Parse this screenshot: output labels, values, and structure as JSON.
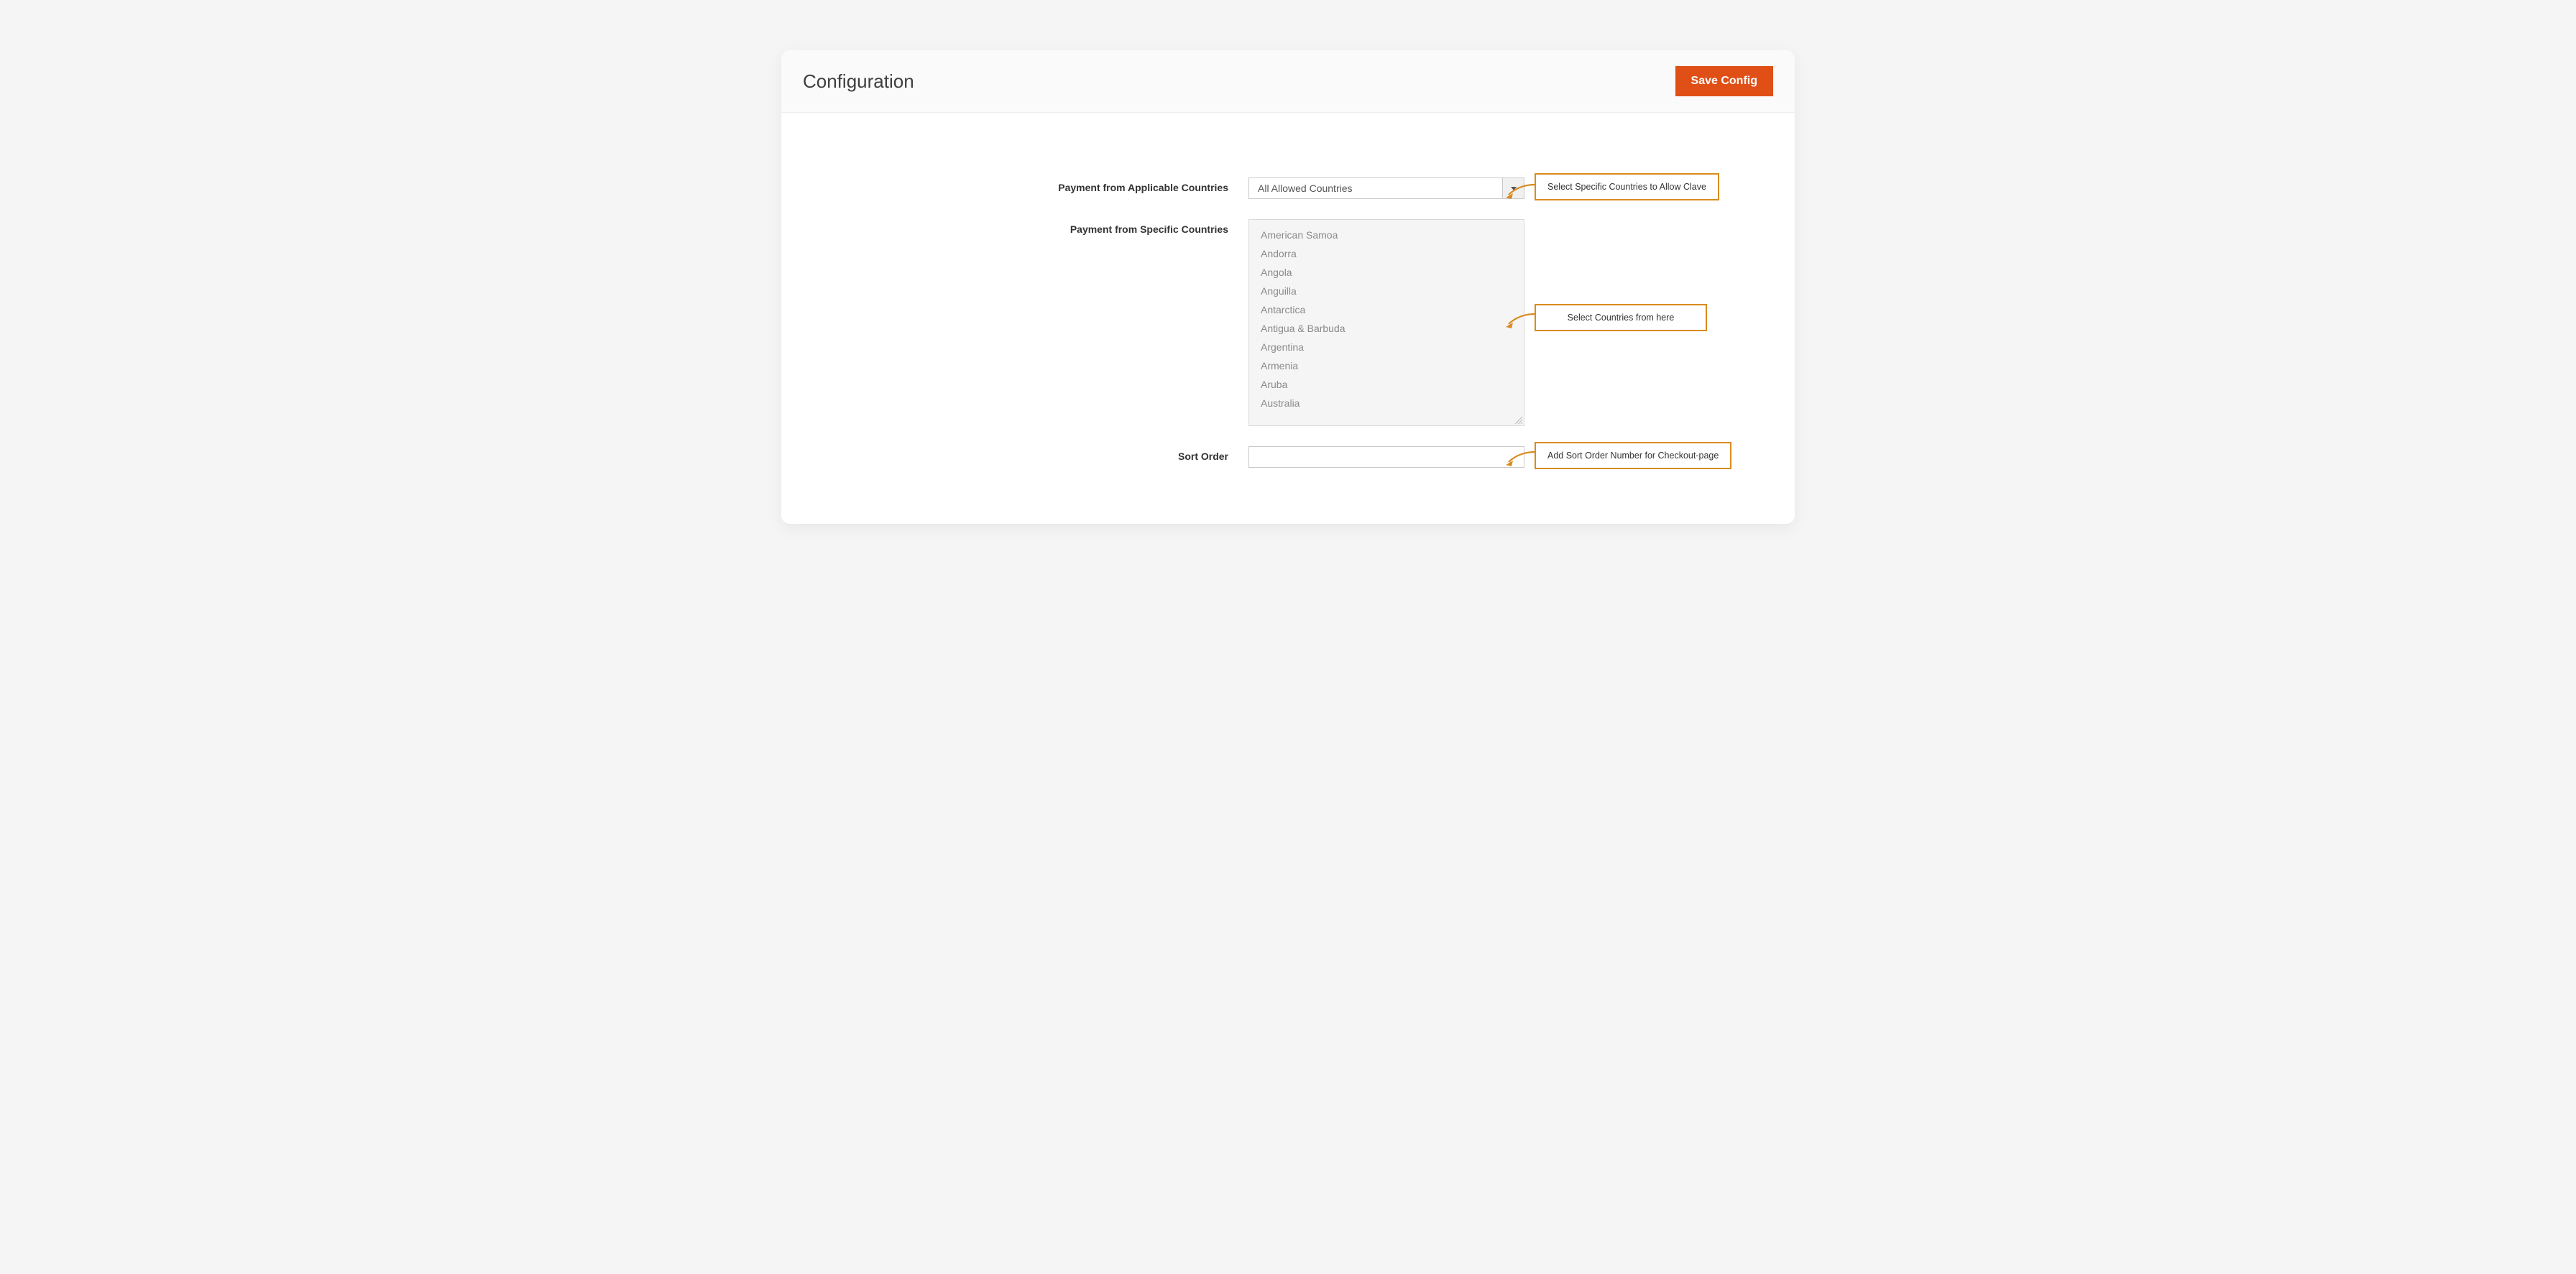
{
  "header": {
    "title": "Configuration",
    "save_label": "Save Config"
  },
  "fields": {
    "applicable": {
      "label": "Payment from Applicable Countries",
      "selected": "All Allowed Countries"
    },
    "specific": {
      "label": "Payment from Specific Countries",
      "options": [
        "American Samoa",
        "Andorra",
        "Angola",
        "Anguilla",
        "Antarctica",
        "Antigua & Barbuda",
        "Argentina",
        "Armenia",
        "Aruba",
        "Australia"
      ]
    },
    "sort_order": {
      "label": "Sort Order",
      "value": ""
    }
  },
  "callouts": {
    "applicable": "Select Specific Countries to Allow Clave",
    "specific": "Select Countries from here",
    "sort_order": "Add Sort Order Number for Checkout-page"
  }
}
